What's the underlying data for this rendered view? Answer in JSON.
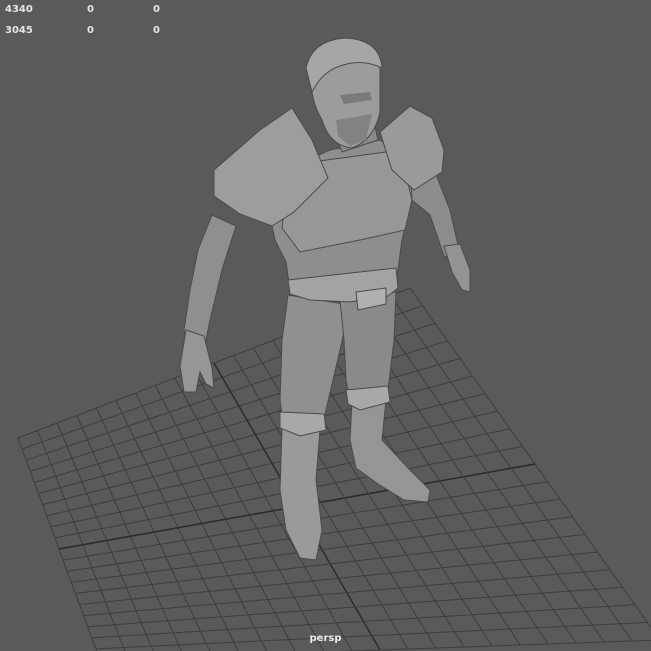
{
  "hud": {
    "rows": [
      {
        "a": "4340",
        "b": "0",
        "c": "0"
      },
      {
        "a": "3045",
        "b": "0",
        "c": "0"
      }
    ]
  },
  "viewport": {
    "camera": "persp",
    "background": "#5a5a5a",
    "grid_color": "#3e3e3e",
    "axis_color": "#2a2a2a",
    "mesh_color": "#9a9a9a"
  }
}
